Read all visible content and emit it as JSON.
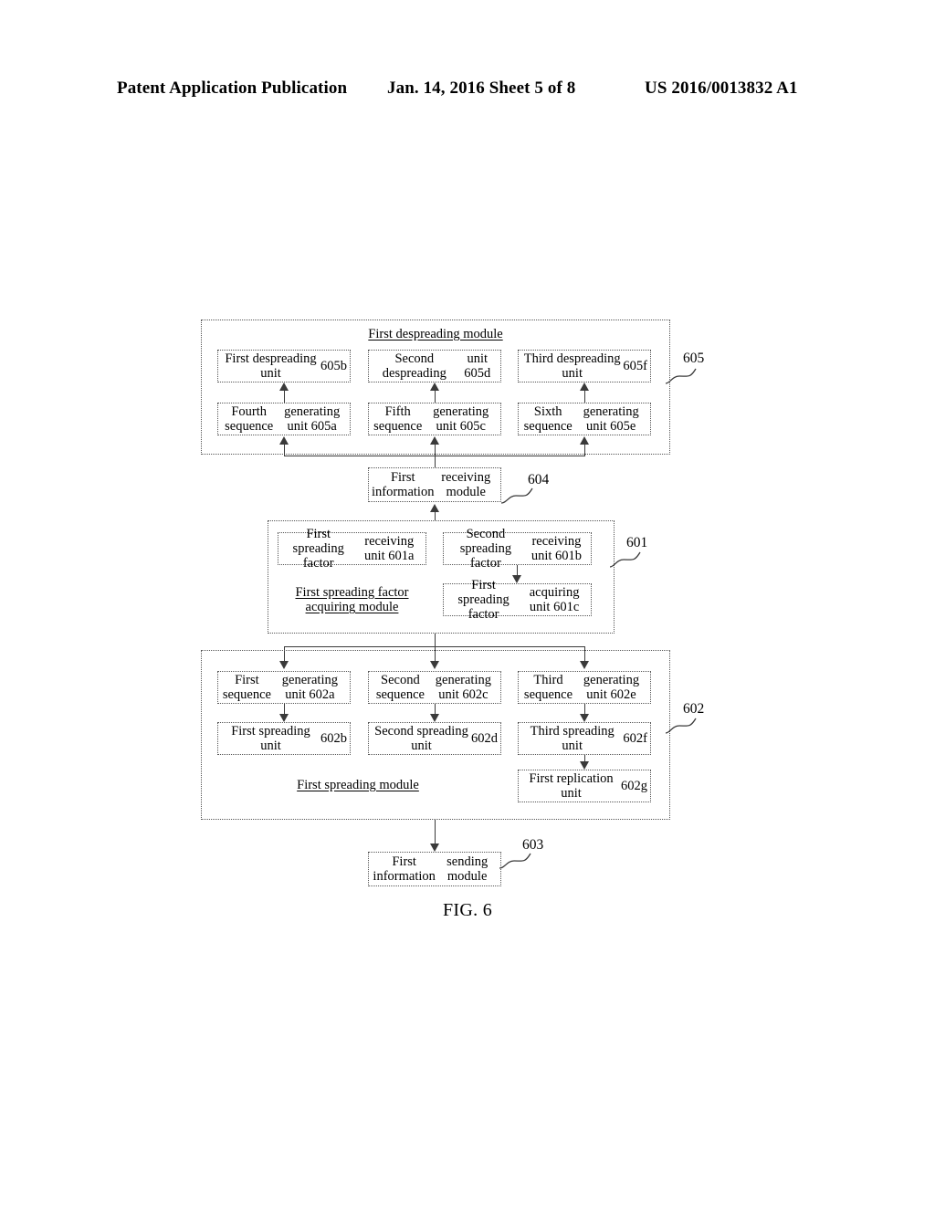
{
  "header": {
    "left": "Patent Application Publication",
    "middle": "Jan. 14, 2016  Sheet 5 of 8",
    "right": "US 2016/0013832 A1"
  },
  "figure": {
    "caption": "FIG. 6",
    "modules": {
      "despreading": {
        "title": "First despreading module",
        "ref": "605",
        "units": [
          {
            "id": "605b",
            "label": "First despreading unit\n605b"
          },
          {
            "id": "605d",
            "label": "Second despreading\nunit 605d"
          },
          {
            "id": "605f",
            "label": "Third despreading unit\n605f"
          },
          {
            "id": "605a",
            "label": "Fourth sequence\ngenerating unit 605a"
          },
          {
            "id": "605c",
            "label": "Fifth sequence\ngenerating unit 605c"
          },
          {
            "id": "605e",
            "label": "Sixth sequence\ngenerating unit 605e"
          }
        ]
      },
      "info_receiving": {
        "label": "First information\nreceiving module",
        "ref": "604"
      },
      "spreading_factor": {
        "title": "First spreading factor\nacquiring module",
        "ref": "601",
        "units": [
          {
            "id": "601a",
            "label": "First spreading factor\nreceiving unit 601a"
          },
          {
            "id": "601b",
            "label": "Second spreading factor\nreceiving unit 601b"
          },
          {
            "id": "601c",
            "label": "First spreading factor\nacquiring unit 601c"
          }
        ]
      },
      "spreading": {
        "title": "First spreading module",
        "ref": "602",
        "units": [
          {
            "id": "602a",
            "label": "First sequence\ngenerating unit 602a"
          },
          {
            "id": "602c",
            "label": "Second sequence\ngenerating unit 602c"
          },
          {
            "id": "602e",
            "label": "Third sequence\ngenerating unit 602e"
          },
          {
            "id": "602b",
            "label": "First spreading unit\n602b"
          },
          {
            "id": "602d",
            "label": "Second spreading unit\n602d"
          },
          {
            "id": "602f",
            "label": "Third spreading unit\n602f"
          },
          {
            "id": "602g",
            "label": "First replication unit\n602g"
          }
        ]
      },
      "info_sending": {
        "label": "First information\nsending module",
        "ref": "603"
      }
    }
  }
}
